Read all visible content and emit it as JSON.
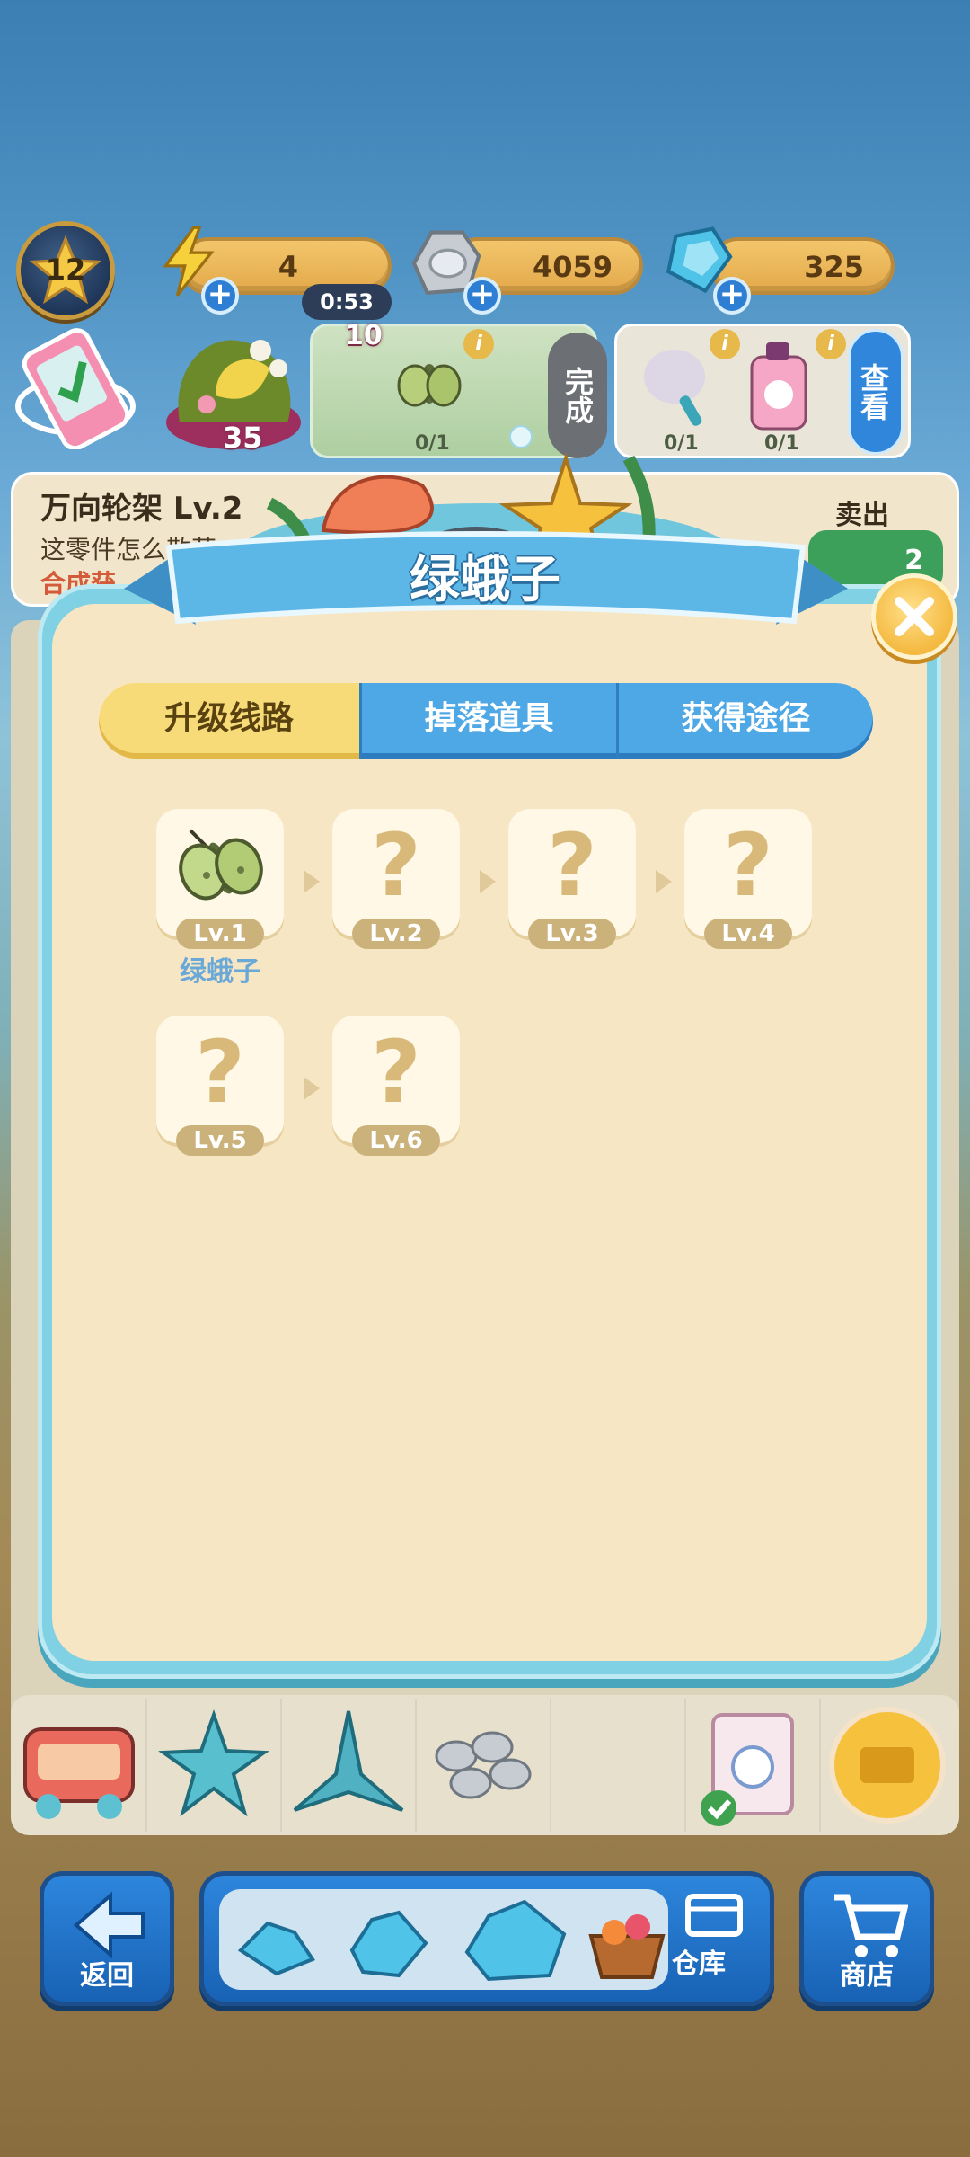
{
  "hud": {
    "player_level": "12",
    "energy": "4",
    "timer": "0:53",
    "coins": "4059",
    "gems": "325"
  },
  "row2": {
    "trophy_count": "35",
    "task_badge_count": "10",
    "task1_progress": "0/1",
    "done_label": "完成",
    "task2_progress_a": "0/1",
    "task2_progress_b": "0/1",
    "view_label": "查看"
  },
  "background_detail": {
    "title": "万向轮架  Lv.2",
    "line1": "这零件怎么散落",
    "line2": "合成获",
    "sell_label": "卖出",
    "sell_value": "2"
  },
  "modal": {
    "title": "绿蛾子",
    "tabs": [
      "升级线路",
      "掉落道具",
      "获得途径"
    ],
    "active_tab": 0,
    "levels": [
      {
        "lv": "Lv.1",
        "name": "绿蛾子",
        "known": true
      },
      {
        "lv": "Lv.2",
        "known": false,
        "placeholder": "?"
      },
      {
        "lv": "Lv.3",
        "known": false,
        "placeholder": "?"
      },
      {
        "lv": "Lv.4",
        "known": false,
        "placeholder": "?"
      },
      {
        "lv": "Lv.5",
        "known": false,
        "placeholder": "?"
      },
      {
        "lv": "Lv.6",
        "known": false,
        "placeholder": "?"
      }
    ]
  },
  "nav": {
    "back_label": "返回",
    "warehouse_label": "仓库",
    "shop_label": "商店"
  },
  "colors": {
    "modal_bg": "#f7e6c3",
    "tab_active": "#f7db79",
    "tab_inactive": "#4fa8e6",
    "nav_blue": "#1f6fc4"
  }
}
